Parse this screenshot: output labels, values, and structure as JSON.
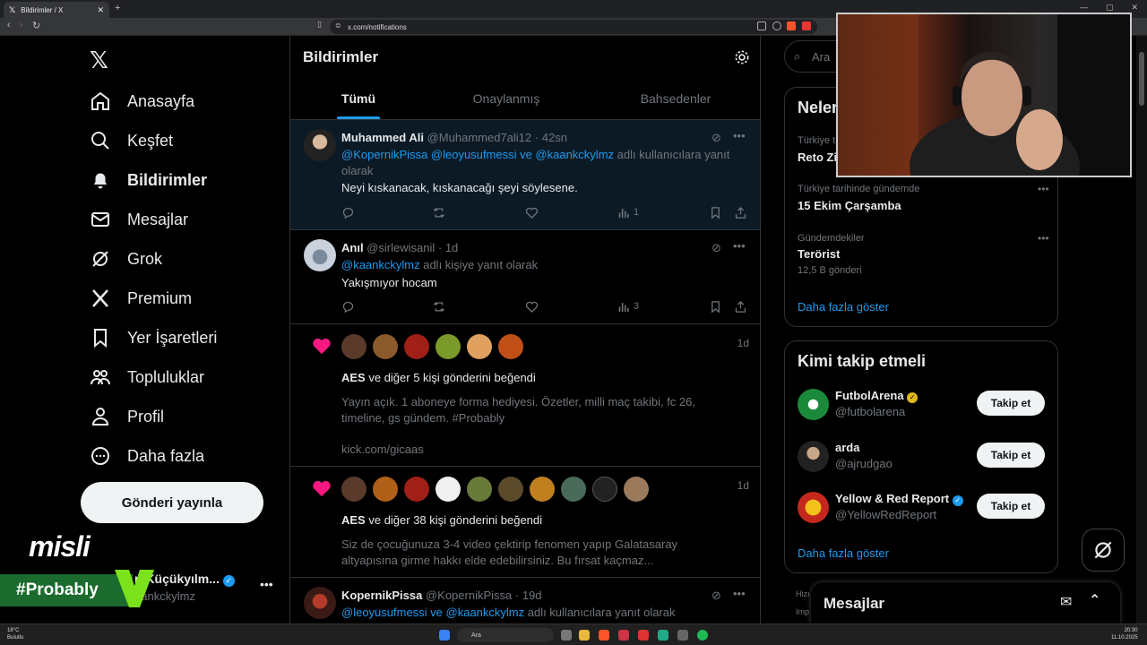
{
  "browser": {
    "tab_title": "Bildirimler / X",
    "tab_icon": "x-logo-icon",
    "url": "x.com/notifications"
  },
  "sidebar": {
    "items": [
      {
        "label": "Anasayfa",
        "icon": "home-icon"
      },
      {
        "label": "Keşfet",
        "icon": "search-icon"
      },
      {
        "label": "Bildirimler",
        "icon": "bell-icon",
        "active": true
      },
      {
        "label": "Mesajlar",
        "icon": "mail-icon"
      },
      {
        "label": "Grok",
        "icon": "grok-icon"
      },
      {
        "label": "Premium",
        "icon": "x-logo-icon"
      },
      {
        "label": "Yer İşaretleri",
        "icon": "bookmark-icon"
      },
      {
        "label": "Topluluklar",
        "icon": "communities-icon"
      },
      {
        "label": "Profil",
        "icon": "person-icon"
      },
      {
        "label": "Daha fazla",
        "icon": "more-circle-icon"
      }
    ],
    "post_button": "Gönderi yayınla",
    "account": {
      "name": "n Küçükyılm...",
      "handle": "aankckylmz"
    }
  },
  "overlay": {
    "misli": "misli",
    "probably": "#Probably"
  },
  "notifications": {
    "title": "Bildirimler",
    "tabs": [
      "Tümü",
      "Onaylanmış",
      "Bahsedenler"
    ],
    "posts": [
      {
        "name": "Muhammed Ali",
        "handle": "@Muhammed7ali12",
        "time": "42sn",
        "reply_links": "@KopernikPissa @leoyusufmessi ve @kaankckylmz",
        "reply_text": " adlı kullanıcılara yanıt",
        "reply_text2": "olarak",
        "body": "Neyi kıskanacak, kıskanacağı şeyi söylesene.",
        "views": "1"
      },
      {
        "name": "Anıl",
        "handle": "@sirlewisanil",
        "time": "1d",
        "reply_links": "@kaankckylmz",
        "reply_text": " adlı kişiye yanıt olarak",
        "body": "Yakışmıyor hocam",
        "views": "3"
      }
    ],
    "likes": [
      {
        "actor": "AES",
        "text": " ve diğer 5 kişi gönderini beğendi",
        "time": "1d",
        "preview1": "Yayın açık. 1 aboneye forma hediyesi. Özetler, milli maç takibi, fc 26,",
        "preview2": "timeline, gs gündem. #Probably",
        "link": "kick.com/gicaas"
      },
      {
        "actor": "AES",
        "text": " ve diğer 38 kişi gönderini beğendi",
        "time": "1d",
        "preview1": "Siz de çocuğunuza 3-4 video çektirip fenomen yapıp Galatasaray",
        "preview2": "altyapısına girme hakkı elde edebilirsiniz. Bu fırsat kaçmaz..."
      }
    ],
    "last_post": {
      "name": "KopernikPissa",
      "handle": "@KopernikPissa",
      "time": "19d",
      "reply_links": "@leoyusufmessi ve @kaankckylmz",
      "reply_text": " adlı kullanıcılara yanıt olarak"
    }
  },
  "right": {
    "search_placeholder": "Ara",
    "trends_title": "Neler",
    "trends": [
      {
        "context": "Türkiye t",
        "topic": "Reto Zi"
      },
      {
        "context": "Türkiye tarihinde gündemde",
        "topic": "15 Ekim Çarşamba"
      },
      {
        "context": "Gündemdekiler",
        "topic": "Terörist",
        "count": "12,5 B gönderi"
      }
    ],
    "show_more": "Daha fazla göster",
    "who_title": "Kimi takip etmeli",
    "who": [
      {
        "name": "FutbolArena",
        "handle": "@futbolarena",
        "button": "Takip et"
      },
      {
        "name": "arda",
        "handle": "@ajrudgao",
        "button": "Takip et"
      },
      {
        "name": "Yellow & Red Report",
        "handle": "@YellowRedReport",
        "button": "Takip et"
      }
    ],
    "footer1": "Hizı",
    "footer2": "Imp",
    "messages": "Mesajlar"
  },
  "taskbar": {
    "temp": "18°C",
    "weather": "Bulutlu",
    "search": "Ara",
    "time": "20:30",
    "date": "11.10.2025"
  },
  "colors": {
    "accent": "#1d9bf0",
    "like": "#f91880",
    "verified_gold": "#e2b719"
  }
}
